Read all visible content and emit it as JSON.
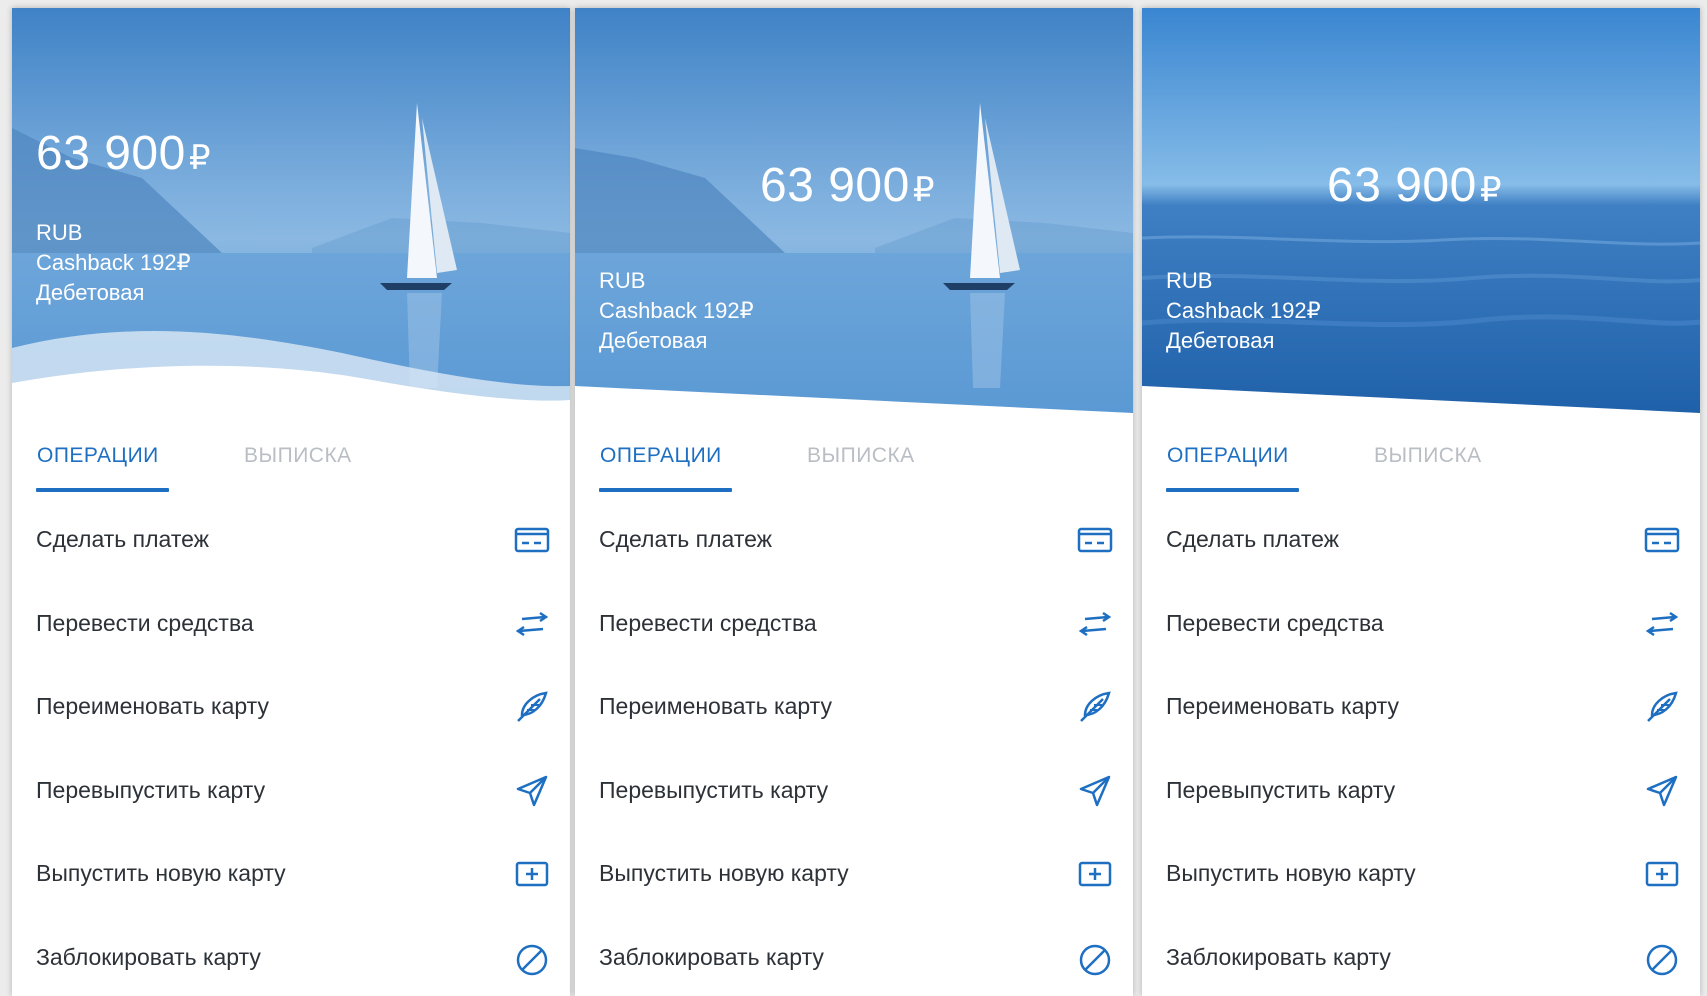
{
  "colors": {
    "accent": "#1e6fc2",
    "tab_inactive": "#b9bec4",
    "text": "#2d3238",
    "sky_top": "#3d7fc2",
    "sea": "#5d9bd6"
  },
  "panels": [
    {
      "variant": "sailboat-wave",
      "balance": {
        "amount": "63 900",
        "currency": "₽"
      },
      "currency_code": "RUB",
      "cashback": "Cashback 192₽",
      "card_type": "Дебетовая",
      "tabs": [
        {
          "label": "ОПЕРАЦИИ"
        },
        {
          "label": "ВЫПИСКА"
        }
      ],
      "actions": [
        {
          "label": "Сделать платеж",
          "icon": "card-icon"
        },
        {
          "label": "Перевести средства",
          "icon": "transfer-icon"
        },
        {
          "label": "Переименовать карту",
          "icon": "feather-icon"
        },
        {
          "label": "Перевыпустить карту",
          "icon": "send-icon"
        },
        {
          "label": "Выпустить новую карту",
          "icon": "add-card-icon"
        },
        {
          "label": "Заблокировать карту",
          "icon": "block-icon"
        }
      ]
    },
    {
      "variant": "sailboat-slant",
      "balance": {
        "amount": "63 900",
        "currency": "₽"
      },
      "currency_code": "RUB",
      "cashback": "Cashback 192₽",
      "card_type": "Дебетовая",
      "tabs": [
        {
          "label": "ОПЕРАЦИИ"
        },
        {
          "label": "ВЫПИСКА"
        }
      ],
      "actions": [
        {
          "label": "Сделать платеж",
          "icon": "card-icon"
        },
        {
          "label": "Перевести средства",
          "icon": "transfer-icon"
        },
        {
          "label": "Переименовать карту",
          "icon": "feather-icon"
        },
        {
          "label": "Перевыпустить карту",
          "icon": "send-icon"
        },
        {
          "label": "Выпустить новую карту",
          "icon": "add-card-icon"
        },
        {
          "label": "Заблокировать карту",
          "icon": "block-icon"
        }
      ]
    },
    {
      "variant": "open-sea-slant",
      "balance": {
        "amount": "63 900",
        "currency": "₽"
      },
      "currency_code": "RUB",
      "cashback": "Cashback 192₽",
      "card_type": "Дебетовая",
      "tabs": [
        {
          "label": "ОПЕРАЦИИ"
        },
        {
          "label": "ВЫПИСКА"
        }
      ],
      "actions": [
        {
          "label": "Сделать платеж",
          "icon": "card-icon"
        },
        {
          "label": "Перевести средства",
          "icon": "transfer-icon"
        },
        {
          "label": "Переименовать карту",
          "icon": "feather-icon"
        },
        {
          "label": "Перевыпустить карту",
          "icon": "send-icon"
        },
        {
          "label": "Выпустить новую карту",
          "icon": "add-card-icon"
        },
        {
          "label": "Заблокировать карту",
          "icon": "block-icon"
        }
      ]
    }
  ]
}
